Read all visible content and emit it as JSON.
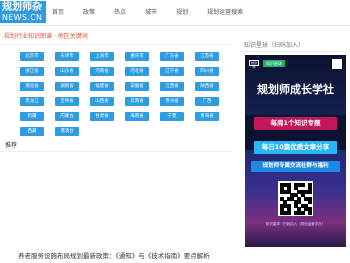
{
  "header": {
    "logo_top": "规划师杂",
    "logo_bottom": "NEWS.CN",
    "nav": [
      "首页",
      "政策",
      "热点",
      "城市",
      "规划",
      "规划运营搜索"
    ]
  },
  "main": {
    "section_title": "规划行业知识图谱 · 地区关键词",
    "regions": [
      [
        "北京市",
        "天津市",
        "上海市",
        "重庆市",
        "广东省",
        "江苏省"
      ],
      [
        "浙江省",
        "山东省",
        "河南省",
        "河北省",
        "辽宁省",
        "四川省"
      ],
      [
        "湖北省",
        "湖南省",
        "福建省",
        "安徽省",
        "江西省",
        "陕西省"
      ],
      [
        "黑龙江",
        "吉林省",
        "山西省",
        "云南省",
        "贵州省",
        "广西"
      ],
      [
        "新疆",
        "内蒙古",
        "甘肃省",
        "海南省",
        "宁夏",
        "青海省"
      ],
      [
        "西藏",
        "港澳台"
      ]
    ],
    "sub_heading": "推荐",
    "article_title": "养老服务设施布局规划最新政策：《通知》与《技术指南》要点解析"
  },
  "sidebar": {
    "title": "知识星球（扫码加入）",
    "poster": {
      "logo": "规划师",
      "tag": "知识星球",
      "headline": "规划师成长学社",
      "banner1": "每周1个知识专题",
      "banner2": "每日10篇优质文章分享",
      "banner3": "规划师专属交流社群与福利",
      "caption": "知识星球 · 扫码加入（规划运营学社）"
    }
  },
  "colors": {
    "accent": "#2f9be0",
    "title_red": "#e8503a"
  }
}
